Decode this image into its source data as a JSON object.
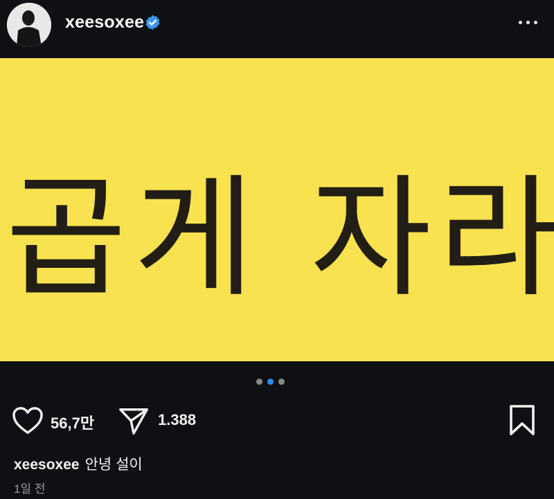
{
  "header": {
    "username": "xeesoxee",
    "verified_icon": "verified-badge-icon",
    "more_icon": "more-options-icon",
    "verified_color": "#3897f0"
  },
  "post": {
    "image_text": "곱게 자라",
    "image_background": "#f8e24f",
    "carousel": {
      "total": 3,
      "active_index": 1
    }
  },
  "actions": {
    "like_icon": "heart-icon",
    "like_count": "56,7만",
    "share_icon": "send-icon",
    "share_count": "1.388",
    "save_icon": "bookmark-icon"
  },
  "caption": {
    "username": "xeesoxee",
    "text": "안녕 설이"
  },
  "timestamp": "1일 전"
}
